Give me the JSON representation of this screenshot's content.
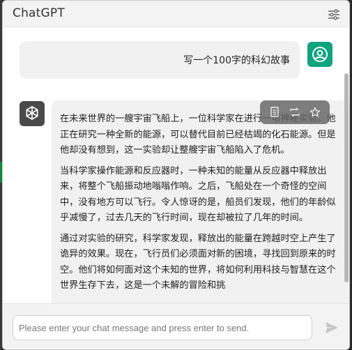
{
  "app": {
    "title": "ChatGPT",
    "settings_icon": "sliders-icon"
  },
  "conversation": {
    "user_message": "写一个100字的科幻故事",
    "user_avatar_icon": "user-circle-icon",
    "bot_avatar_icon": "openai-logo-icon",
    "assistant_paragraphs": [
      "在未来世界的一艘宇宙飞船上，一位科学家在进行一项神秘实验。他正在研究一种全新的能源，可以替代目前已经枯竭的化石能源。但是他却没有想到，这一实验却让整艘宇宙飞船陷入了危机。",
      "当科学家操作能源和反应器时，一种未知的能量从反应器中释放出来，将整个飞船振动地嗡嗡作响。之后，飞船处在一个奇怪的空间中，没有地方可以飞行。令人惊讶的是，船员们发现，他们的年龄似乎减慢了，过去几天的飞行时间，现在却被拉了几年的时间。",
      "通过对实验的研究，科学家发现，释放出的能量在跨越时空上产生了诡异的效果。现在，飞行员们必须面对新的困境，寻找回到原来的时空。他们将如何面对这个未知的世界，将如何利用科技与智慧在这个世界生存下去，这是一个未解的冒险和挑"
    ],
    "actions": [
      {
        "name": "copy",
        "icon": "copy-icon"
      },
      {
        "name": "regenerate",
        "icon": "repeat-icon"
      },
      {
        "name": "favorite",
        "icon": "star-icon"
      }
    ]
  },
  "composer": {
    "placeholder": "Please enter your chat message and press enter to send.",
    "value": "",
    "send_icon": "send-icon"
  },
  "colors": {
    "accent_green": "#10a37f",
    "bubble_bg": "#f1f1f1",
    "header_bg": "#f3f3f3",
    "bot_avatar_bg": "#4a4a4a"
  }
}
